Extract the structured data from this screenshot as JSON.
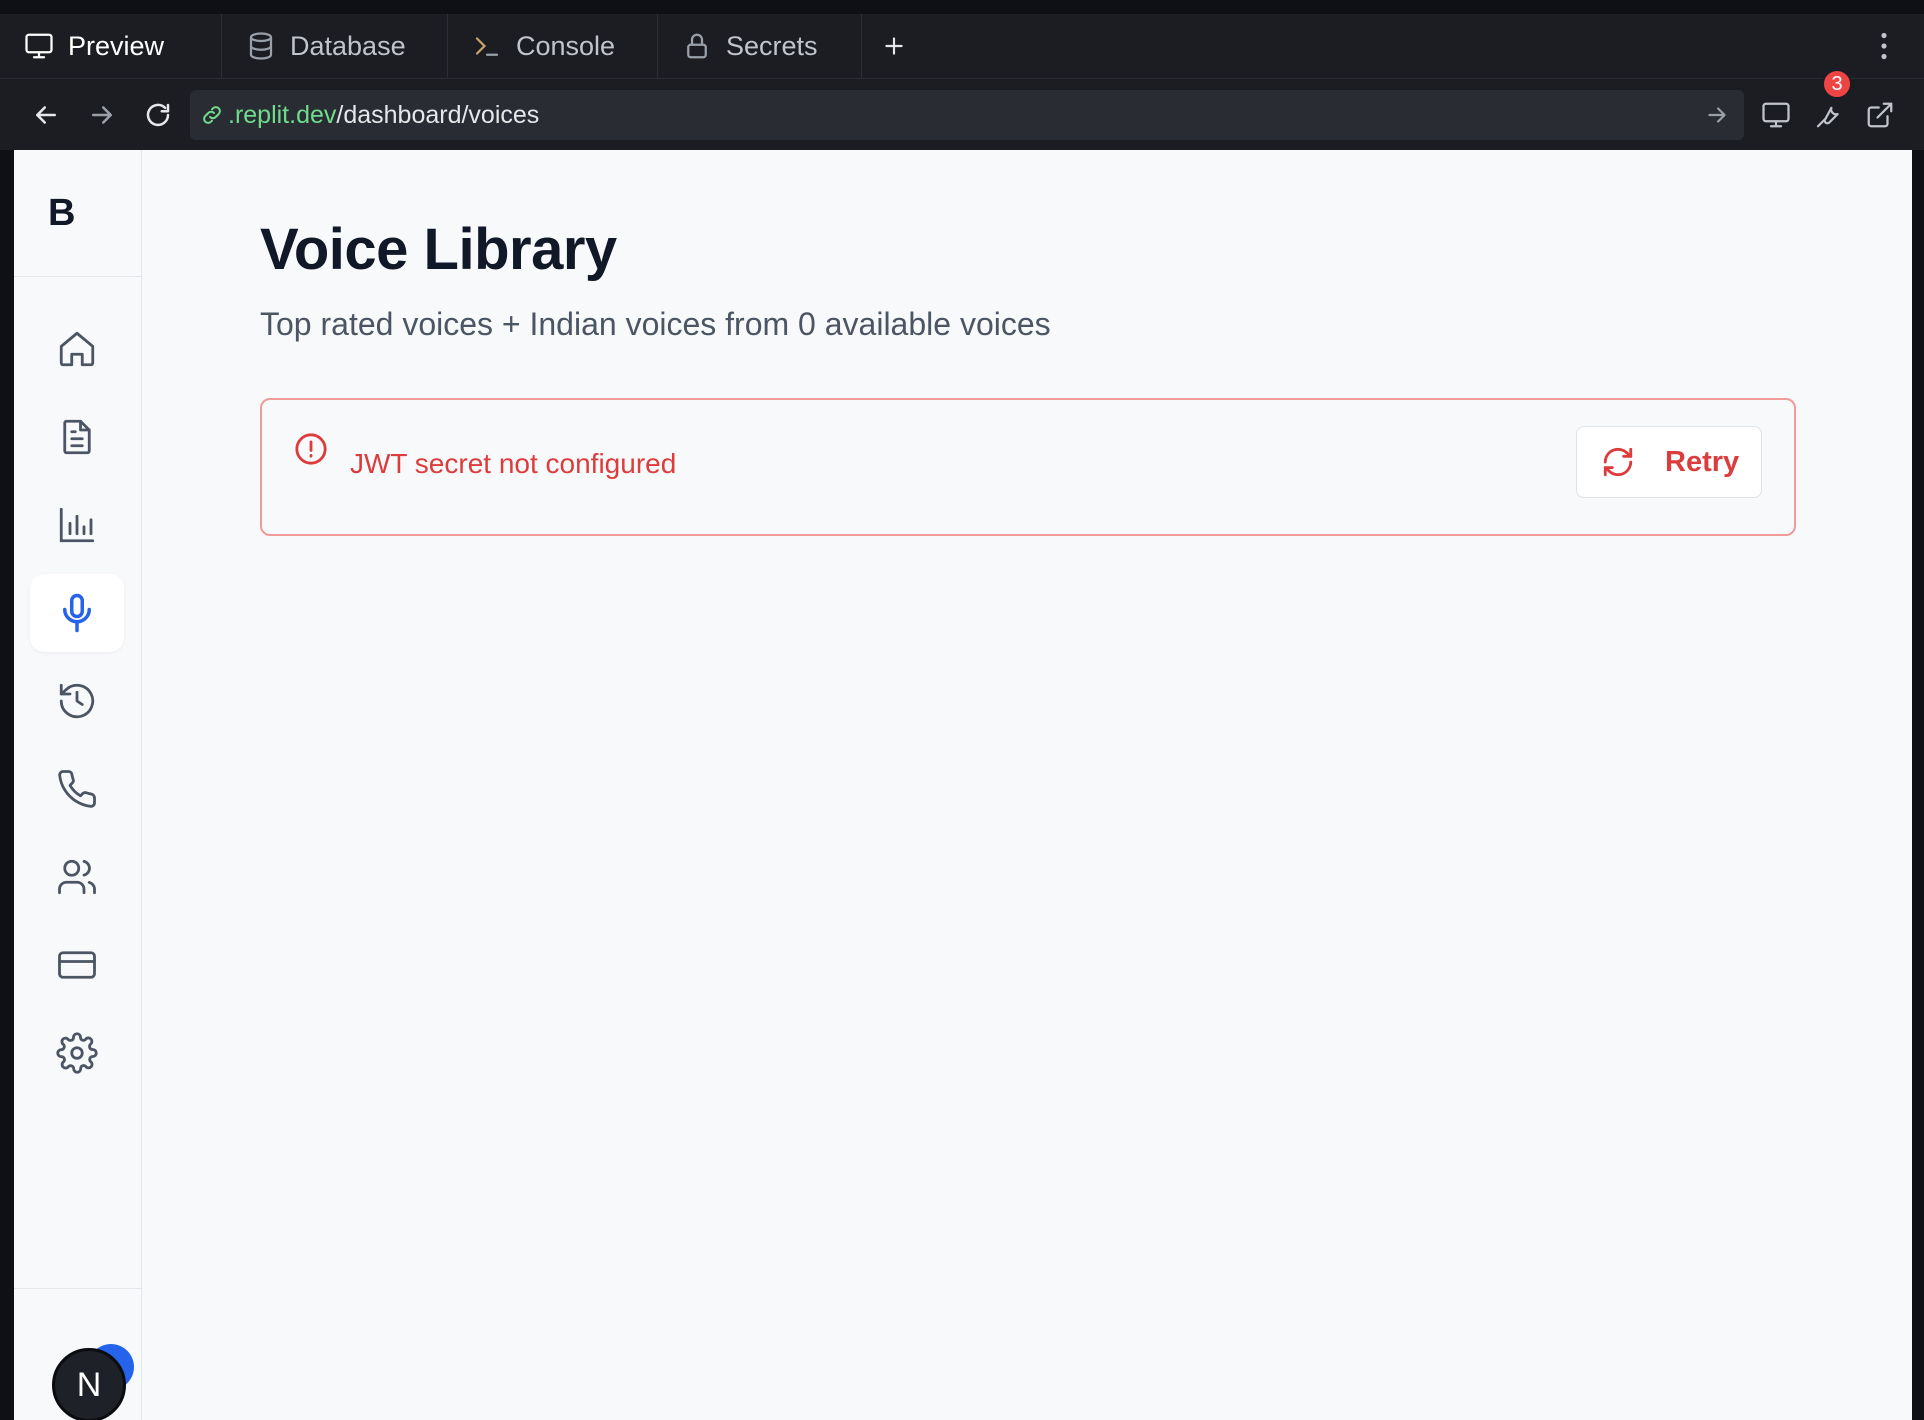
{
  "tabs": [
    {
      "label": "Preview",
      "icon": "monitor-icon",
      "active": true
    },
    {
      "label": "Database",
      "icon": "database-icon",
      "active": false
    },
    {
      "label": "Console",
      "icon": "terminal-icon",
      "active": false
    },
    {
      "label": "Secrets",
      "icon": "lock-icon",
      "active": false
    }
  ],
  "address": {
    "domain": ".replit.dev",
    "path": "/dashboard/voices"
  },
  "toolbar": {
    "badge_count": "3"
  },
  "sidebar": {
    "logo": "B",
    "items": [
      {
        "name": "home",
        "icon": "home-icon",
        "active": false
      },
      {
        "name": "documents",
        "icon": "document-icon",
        "active": false
      },
      {
        "name": "analytics",
        "icon": "bar-chart-icon",
        "active": false
      },
      {
        "name": "voices",
        "icon": "microphone-icon",
        "active": true
      },
      {
        "name": "history",
        "icon": "history-icon",
        "active": false
      },
      {
        "name": "calls",
        "icon": "phone-icon",
        "active": false
      },
      {
        "name": "contacts",
        "icon": "users-icon",
        "active": false
      },
      {
        "name": "billing",
        "icon": "credit-card-icon",
        "active": false
      },
      {
        "name": "settings",
        "icon": "gear-icon",
        "active": false
      }
    ],
    "avatar_initial": "N"
  },
  "main": {
    "title": "Voice Library",
    "subtitle": "Top rated voices + Indian voices from 0 available voices",
    "error": {
      "message": "JWT secret not configured",
      "retry_label": "Retry"
    }
  },
  "colors": {
    "accent": "#2563eb",
    "error": "#dc3c3c",
    "error_border": "#f19a9a",
    "url_domain": "#6fdc8c"
  }
}
